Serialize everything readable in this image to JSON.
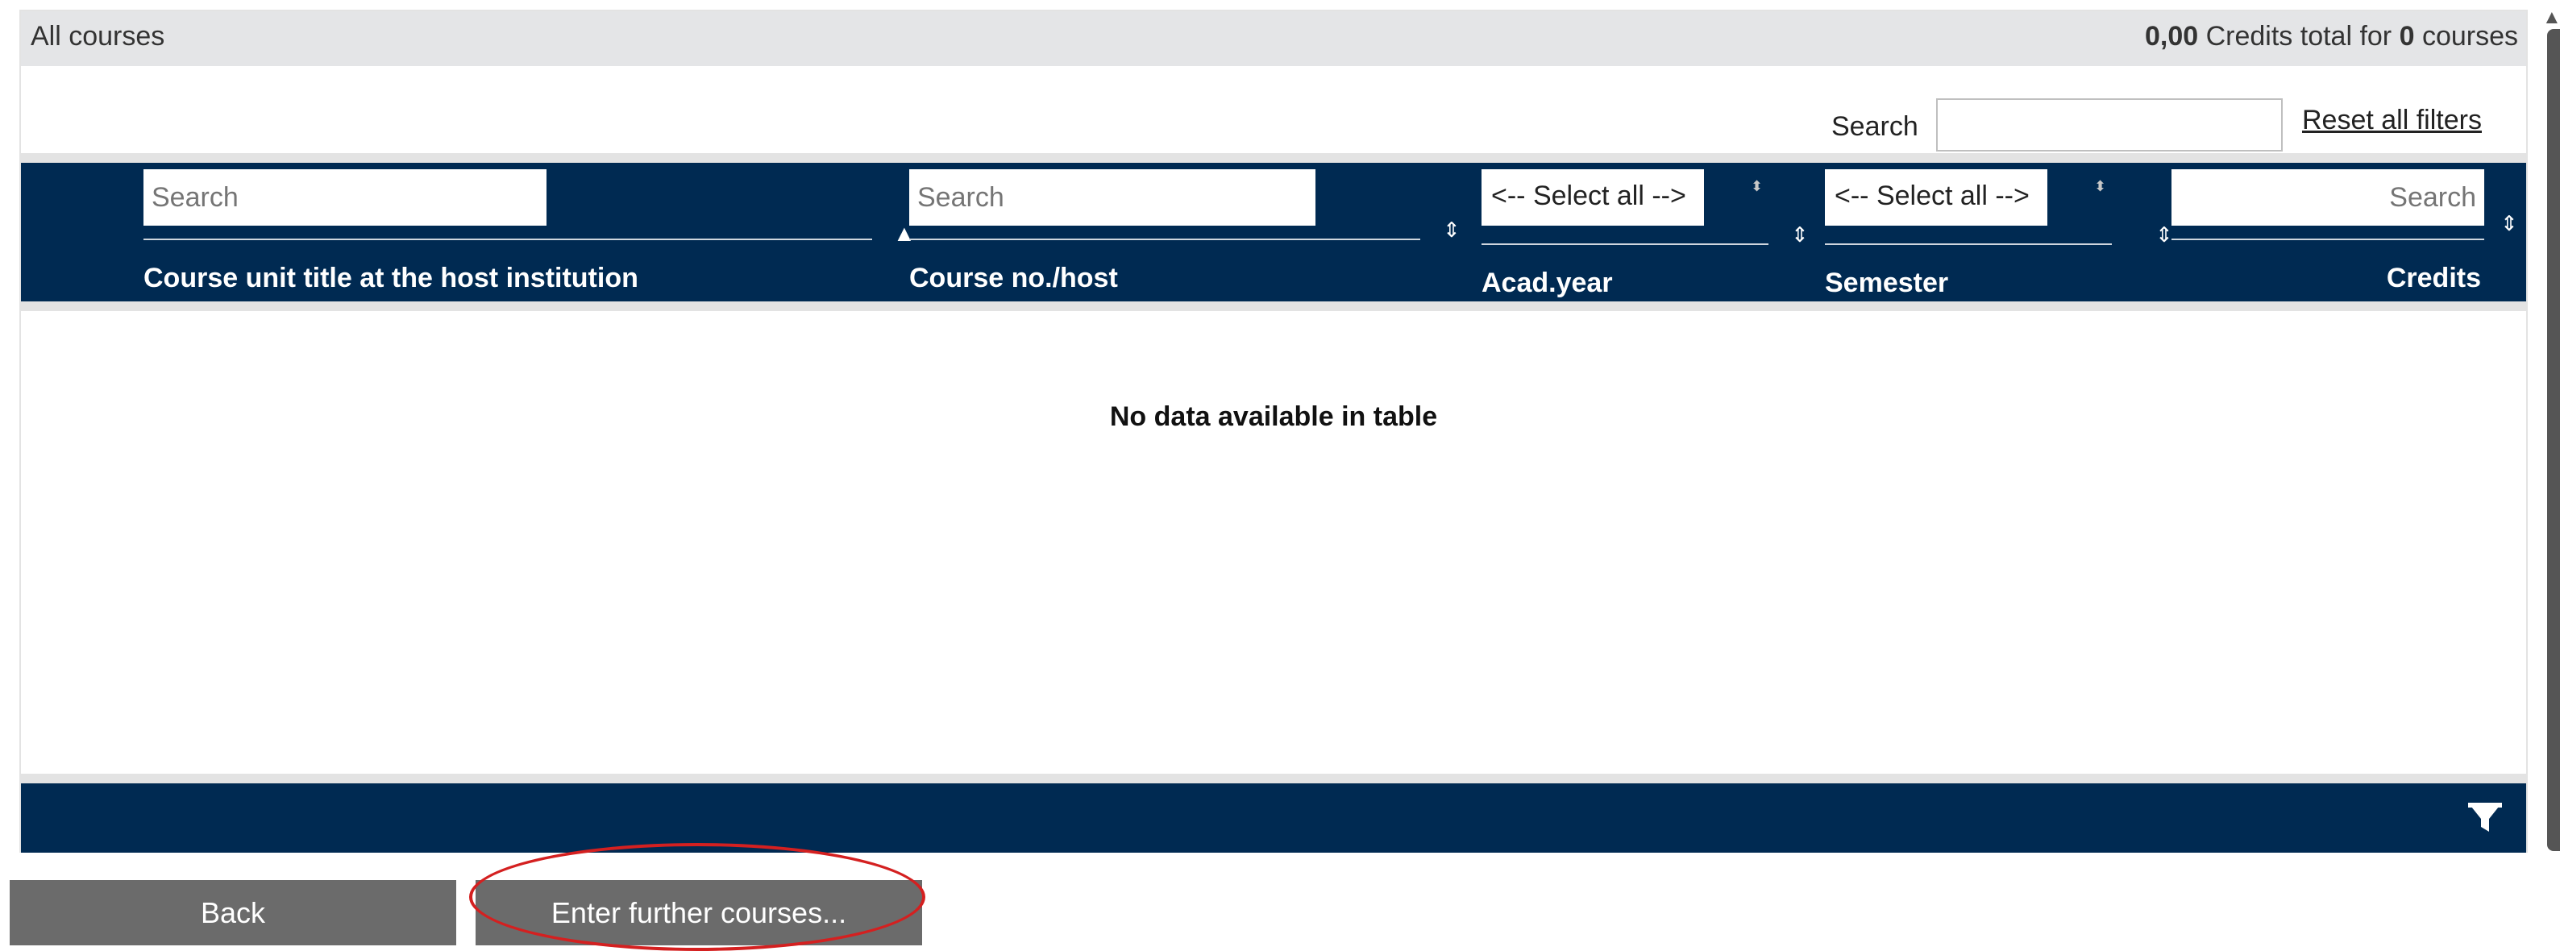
{
  "panel": {
    "title": "All courses",
    "summary": {
      "credits_value": "0,00",
      "credits_text": " Credits total for ",
      "course_count": "0",
      "courses_text": " courses"
    }
  },
  "global_search": {
    "label": "Search",
    "value": "",
    "reset_label": "Reset all filters"
  },
  "columns": [
    {
      "label": "Course unit title at the host institution",
      "filter_type": "text",
      "filter_placeholder": "Search",
      "sort": "ascending"
    },
    {
      "label": "Course no./host",
      "filter_type": "text",
      "filter_placeholder": "Search",
      "sort": "none"
    },
    {
      "label": "Acad.year",
      "filter_type": "select",
      "filter_selected": "<-- Select all -->",
      "sort": "none"
    },
    {
      "label": "Semester",
      "filter_type": "select",
      "filter_selected": "<-- Select all -->",
      "sort": "none"
    },
    {
      "label": "Credits",
      "filter_type": "text",
      "filter_placeholder": "Search",
      "sort": "none"
    }
  ],
  "table": {
    "empty_message": "No data available in table"
  },
  "buttons": {
    "back_label": "Back",
    "enter_further_label": "Enter further courses..."
  },
  "colors": {
    "header_bg": "#002a52",
    "panel_header_bg": "#e4e5e7",
    "button_bg": "#6b6b6b",
    "highlight": "#d42020"
  },
  "icons": {
    "sort_ascending": "sort-up-icon",
    "sort_both": "sort-both-icon",
    "filter": "filter-funnel-icon"
  }
}
